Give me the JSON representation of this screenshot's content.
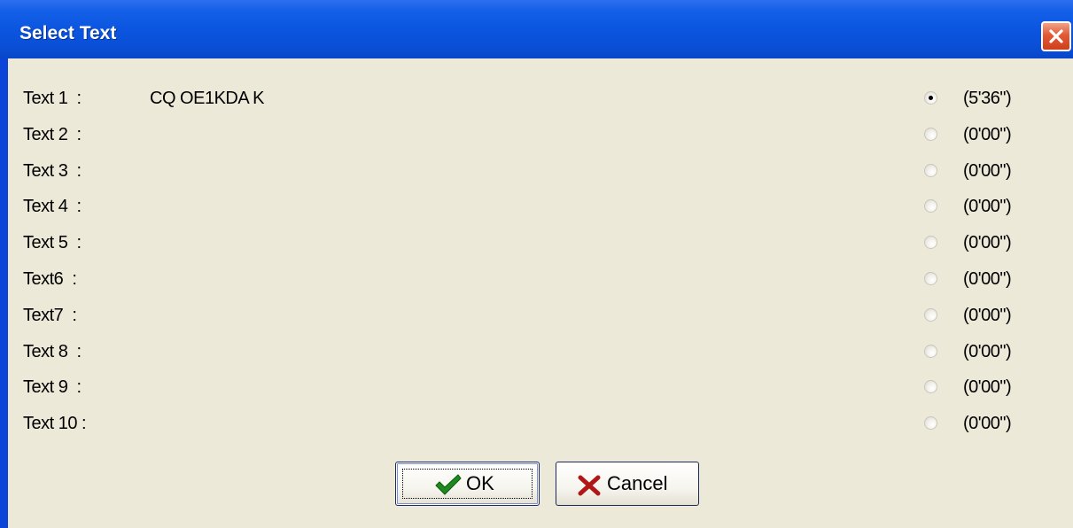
{
  "window": {
    "title": "Select Text"
  },
  "texts": [
    {
      "label": "Text 1  :",
      "text": "CQ OE1KDA K",
      "time": "(5'36\")",
      "selected": true
    },
    {
      "label": "Text 2  :",
      "text": "",
      "time": "(0'00\")",
      "selected": false
    },
    {
      "label": "Text 3  :",
      "text": "",
      "time": "(0'00\")",
      "selected": false
    },
    {
      "label": "Text 4  :",
      "text": "",
      "time": "(0'00\")",
      "selected": false
    },
    {
      "label": "Text 5  :",
      "text": "",
      "time": "(0'00\")",
      "selected": false
    },
    {
      "label": "Text6  :",
      "text": "",
      "time": "(0'00\")",
      "selected": false
    },
    {
      "label": "Text7  :",
      "text": "",
      "time": "(0'00\")",
      "selected": false
    },
    {
      "label": "Text 8  :",
      "text": "",
      "time": "(0'00\")",
      "selected": false
    },
    {
      "label": "Text 9  :",
      "text": "",
      "time": "(0'00\")",
      "selected": false
    },
    {
      "label": "Text 10 :",
      "text": "",
      "time": "(0'00\")",
      "selected": false
    }
  ],
  "buttons": {
    "ok_label": "OK",
    "cancel_label": "Cancel"
  },
  "icons": {
    "close": "close-icon",
    "ok": "checkmark-icon",
    "cancel": "x-icon"
  },
  "colors": {
    "titlebar": "#0a4fd6",
    "client_bg": "#ece9d8",
    "close_button": "#e25a36",
    "ok_check": "#1c8a1c",
    "cancel_x": "#b01818"
  }
}
